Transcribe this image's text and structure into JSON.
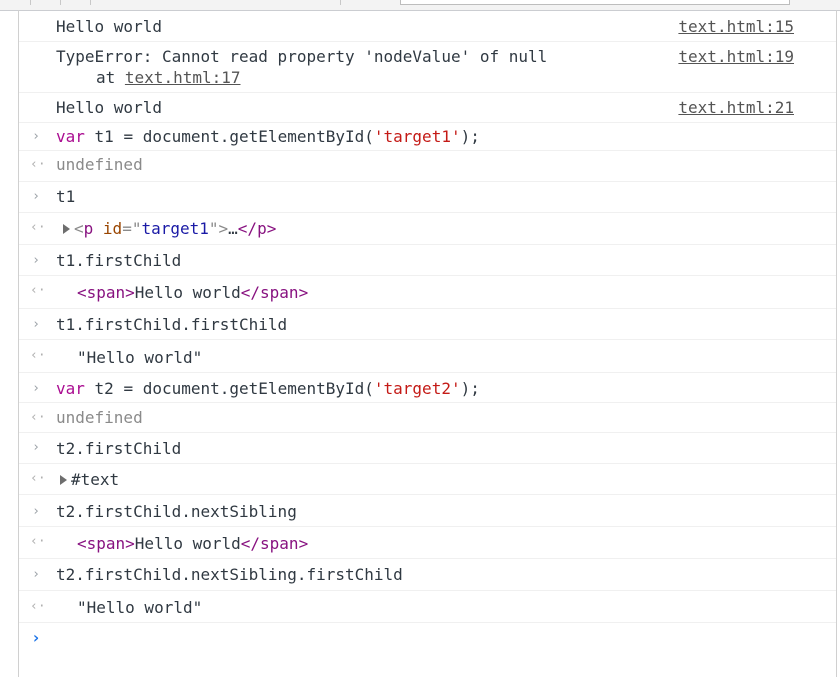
{
  "messages": [
    {
      "text": "Hello world",
      "source": "text.html:15"
    },
    {
      "text": "TypeError: Cannot read property 'nodeValue' of null",
      "trace_prefix": "at ",
      "trace_link": "text.html:17",
      "source": "text.html:19"
    },
    {
      "text": "Hello world",
      "source": "text.html:21"
    }
  ],
  "entries": [
    {
      "kw": "var",
      "rest": " t1 = document.getElementById(",
      "str": "'target1'",
      "end": ");",
      "result": "undefined"
    },
    {
      "cmd": "t1",
      "result_open": "<",
      "result_tag": "p",
      "result_attr": " id",
      "result_eq": "=\"",
      "result_attrv": "target1",
      "result_close": "\">",
      "result_ellipsis": "…",
      "result_end": "</p>"
    },
    {
      "cmd": "t1.firstChild",
      "result_a": "<span>",
      "result_b": "Hello world",
      "result_c": "</span>"
    },
    {
      "cmd": "t1.firstChild.firstChild",
      "result": "\"Hello world\""
    },
    {
      "kw": "var",
      "rest": " t2 = document.getElementById(",
      "str": "'target2'",
      "end": ");",
      "result": "undefined"
    },
    {
      "cmd": "t2.firstChild",
      "result": "#text"
    },
    {
      "cmd": "t2.firstChild.nextSibling",
      "result_a": "<span>",
      "result_b": "Hello world",
      "result_c": "</span>"
    },
    {
      "cmd": "t2.firstChild.nextSibling.firstChild",
      "result": "\"Hello world\""
    }
  ],
  "icons": {
    "input_prompt": "›",
    "result_arrow": "‹·",
    "expand_arrow": "triangle-right",
    "active_prompt": "›"
  },
  "colors": {
    "keyword": "#aa0d91",
    "string": "#c41a16",
    "tag": "#881280",
    "attr_name": "#994500",
    "attr_value": "#1a1aa6",
    "prompt_active": "#1a73e8"
  }
}
